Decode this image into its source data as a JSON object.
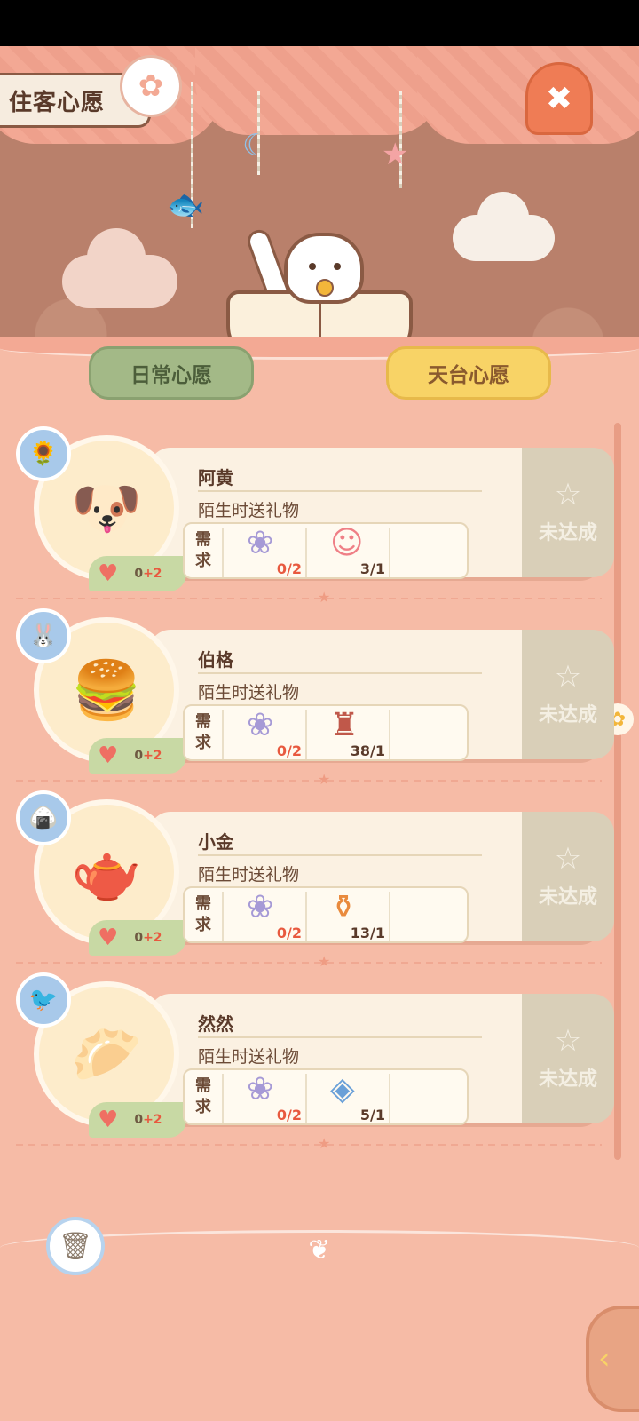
{
  "header": {
    "title": "住客心愿"
  },
  "tabs": [
    {
      "label": "日常心愿",
      "active": false
    },
    {
      "label": "天台心愿",
      "active": true
    }
  ],
  "wishes": [
    {
      "name": "阿黄",
      "request": "陌生时送礼物",
      "need_label": "需求",
      "heart_value": "0",
      "heart_bonus": "+2",
      "items": [
        {
          "icon": "lavender-icon",
          "count": "0/2"
        },
        {
          "icon": "doll-icon",
          "count": "3/1"
        }
      ],
      "status": "未达成"
    },
    {
      "name": "伯格",
      "request": "陌生时送礼物",
      "need_label": "需求",
      "heart_value": "0",
      "heart_bonus": "+2",
      "items": [
        {
          "icon": "lavender-icon",
          "count": "0/2"
        },
        {
          "icon": "cat-stand-icon",
          "count": "38/1"
        }
      ],
      "status": "未达成"
    },
    {
      "name": "小金",
      "request": "陌生时送礼物",
      "need_label": "需求",
      "heart_value": "0",
      "heart_bonus": "+2",
      "items": [
        {
          "icon": "lavender-icon",
          "count": "0/2"
        },
        {
          "icon": "jar-icon",
          "count": "13/1"
        }
      ],
      "status": "未达成"
    },
    {
      "name": "然然",
      "request": "陌生时送礼物",
      "need_label": "需求",
      "heart_value": "0",
      "heart_bonus": "+2",
      "items": [
        {
          "icon": "lavender-icon",
          "count": "0/2"
        },
        {
          "icon": "gem-box-icon",
          "count": "5/1"
        }
      ],
      "status": "未达成"
    }
  ]
}
